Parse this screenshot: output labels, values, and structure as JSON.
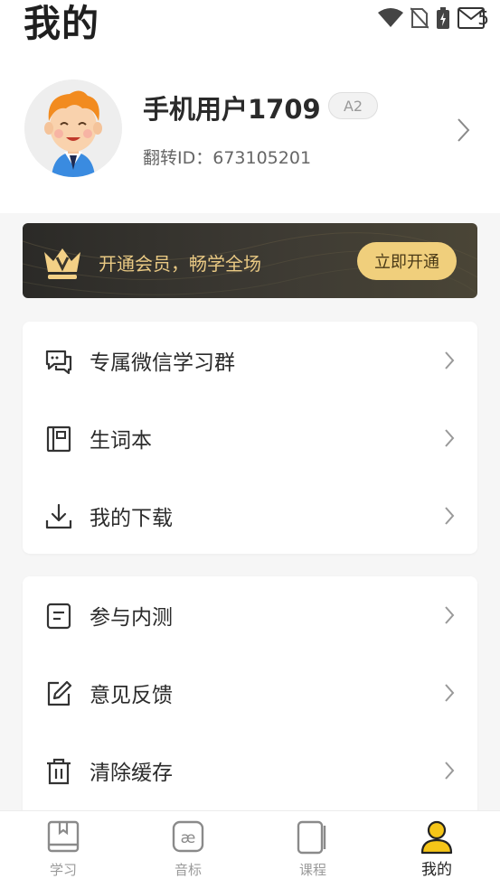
{
  "header": {
    "title": "我的"
  },
  "status_bar": {
    "time": "5"
  },
  "profile": {
    "name": "手机用户1709",
    "level": "A2",
    "id_label": "翻转ID：673105201"
  },
  "vip": {
    "text": "开通会员，畅学全场",
    "button": "立即开通"
  },
  "menu_group_1": [
    {
      "label": "专属微信学习群",
      "icon": "chat-icon"
    },
    {
      "label": "生词本",
      "icon": "notebook-icon"
    },
    {
      "label": "我的下载",
      "icon": "download-icon"
    }
  ],
  "menu_group_2": [
    {
      "label": "参与内测",
      "icon": "document-icon"
    },
    {
      "label": "意见反馈",
      "icon": "edit-icon"
    },
    {
      "label": "清除缓存",
      "icon": "trash-icon"
    }
  ],
  "tabs": [
    {
      "label": "学习",
      "icon": "book-icon"
    },
    {
      "label": "音标",
      "icon": "phonetic-icon"
    },
    {
      "label": "课程",
      "icon": "course-icon"
    },
    {
      "label": "我的",
      "icon": "user-icon"
    }
  ],
  "colors": {
    "accent": "#f5c518",
    "vip_gold": "#e9c983",
    "vip_button": "#f0cf7c",
    "vip_bg": "#2b2a27"
  }
}
